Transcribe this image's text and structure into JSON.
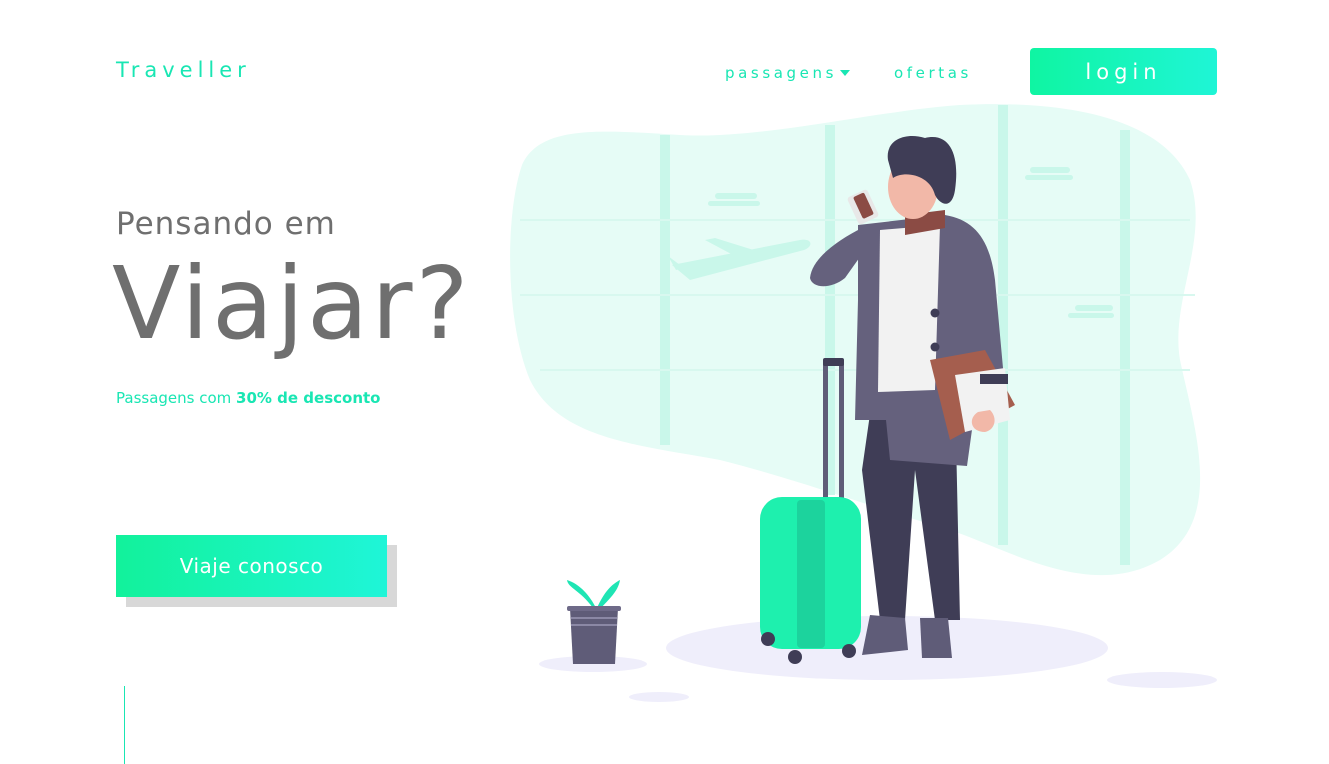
{
  "header": {
    "brand": "Traveller",
    "nav": [
      {
        "label": "passagens",
        "has_dropdown": true
      },
      {
        "label": "ofertas",
        "has_dropdown": false
      }
    ],
    "login_label": "login"
  },
  "hero": {
    "pre_title": "Pensando em",
    "title": "Viajar?",
    "subtitle_prefix": "Passagens com ",
    "subtitle_highlight": "30% de desconto",
    "cta_label": "Viaje conosco"
  },
  "colors": {
    "accent": "#19e6b3",
    "button_gradient_start": "#0ff5a2",
    "button_gradient_end": "#1ff5d6",
    "text_gray": "#6f6f6f",
    "blob": "#e6fcf6"
  }
}
